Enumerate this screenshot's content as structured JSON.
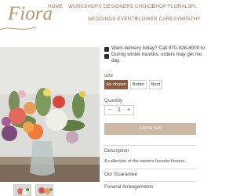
{
  "brand": {
    "logo_text": "Fiora",
    "logo_color": "#b8956a"
  },
  "nav": {
    "row1": [
      "HOME",
      "WORKSHOPS",
      "DESIGNERS CHOICE",
      "SHOP FLORALS",
      "PL"
    ],
    "row2": [
      "WEDDINGS EVENTS",
      "FLOWER CARE",
      "SYMPATHY"
    ]
  },
  "product": {
    "delivery_line1": "Want delivery today? Call 970-828-8000 to",
    "delivery_line2": "During winter months, orders may get mo",
    "delivery_line3": "day.",
    "size_label": "size",
    "sizes": [
      "As shown",
      "Better",
      "Best"
    ],
    "selected_size": "As shown",
    "quantity_label": "Quantity",
    "quantity_value": "1",
    "minus": "−",
    "plus": "+",
    "add_to_cart": "Add to cart"
  },
  "accordion": {
    "description_title": "Description",
    "description_text": "A collection of the owners favorite flowers.",
    "guarantee_title": "Our Guarantee",
    "funeral_title": "Funeral Arrangements"
  },
  "colors": {
    "accent": "#8a5d3e",
    "button_muted": "#cdb8a6",
    "nav_text": "#8a7260"
  }
}
